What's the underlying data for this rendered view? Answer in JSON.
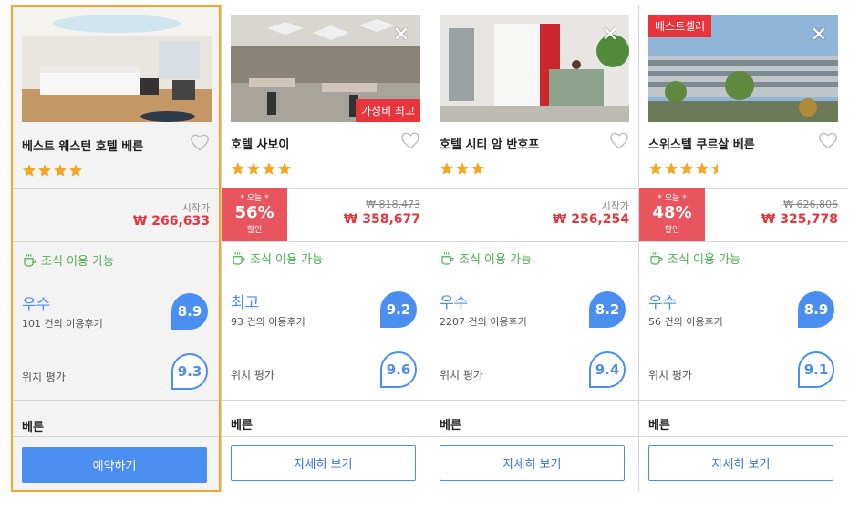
{
  "currency_symbol": "₩",
  "accent_colors": {
    "selected_border": "#f5a623",
    "price_red": "#e8353d",
    "score_blue": "#4a8ef0",
    "breakfast_green": "#4caf50"
  },
  "hotels": [
    {
      "name": "베스트 웨스턴 호텔 베른",
      "stars": 4,
      "start_label": "시작가",
      "price": "₩ 266,633",
      "breakfast": "조식 이용 가능",
      "score_label": "우수",
      "reviews": "101 건의 이용후기",
      "score": "8.9",
      "location_label": "위치 평가",
      "location_score": "9.3",
      "city": "베른",
      "button": "예약하기"
    },
    {
      "name": "호텔 사보이",
      "stars": 4,
      "image_badge": "가성비 최고",
      "deal_top": "* 오늘 *",
      "deal_pct": "56%",
      "deal_bottom": "할인",
      "old_price": "₩ 818,473",
      "price": "₩ 358,677",
      "breakfast": "조식 이용 가능",
      "score_label": "최고",
      "reviews": "93 건의 이용후기",
      "score": "9.2",
      "location_label": "위치 평가",
      "location_score": "9.6",
      "city": "베른",
      "button": "자세히 보기"
    },
    {
      "name": "호텔 시티 암 반호프",
      "stars": 3,
      "start_label": "시작가",
      "price": "₩ 256,254",
      "breakfast": "조식 이용 가능",
      "score_label": "우수",
      "reviews": "2207 건의 이용후기",
      "score": "8.2",
      "location_label": "위치 평가",
      "location_score": "9.4",
      "city": "베른",
      "button": "자세히 보기"
    },
    {
      "name": "스위스텔 쿠르살 베른",
      "stars": 4.5,
      "top_badge": "베스트셀러",
      "deal_top": "* 오늘 *",
      "deal_pct": "48%",
      "deal_bottom": "할인",
      "old_price": "₩ 626,806",
      "price": "₩ 325,778",
      "breakfast": "조식 이용 가능",
      "score_label": "우수",
      "reviews": "56 건의 이용후기",
      "score": "8.9",
      "location_label": "위치 평가",
      "location_score": "9.1",
      "city": "베른",
      "button": "자세히 보기"
    }
  ]
}
